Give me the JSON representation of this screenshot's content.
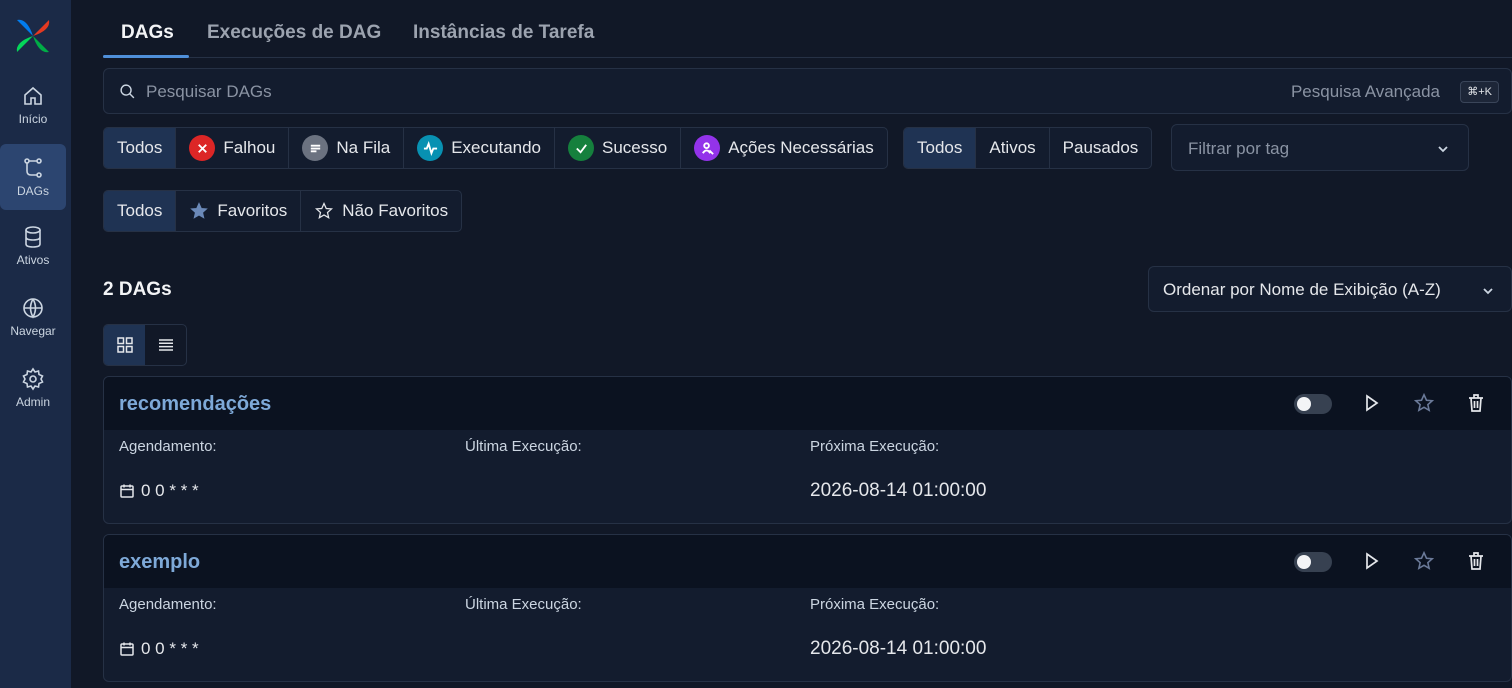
{
  "sidebar": {
    "items": [
      {
        "label": "Início",
        "icon": "home-icon"
      },
      {
        "label": "DAGs",
        "icon": "dags-icon"
      },
      {
        "label": "Ativos",
        "icon": "database-icon"
      },
      {
        "label": "Navegar",
        "icon": "globe-icon"
      },
      {
        "label": "Admin",
        "icon": "gear-icon"
      }
    ]
  },
  "tabs": [
    {
      "label": "DAGs"
    },
    {
      "label": "Execuções de DAG"
    },
    {
      "label": "Instâncias de Tarefa"
    }
  ],
  "search": {
    "placeholder": "Pesquisar DAGs",
    "advanced_label": "Pesquisa Avançada",
    "shortcut": "⌘+K"
  },
  "state_filters": {
    "all": "Todos",
    "failed": "Falhou",
    "queued": "Na Fila",
    "running": "Executando",
    "success": "Sucesso",
    "needs_action": "Ações Necessárias"
  },
  "active_filters": {
    "all": "Todos",
    "active": "Ativos",
    "paused": "Pausados"
  },
  "tag_filter": {
    "placeholder": "Filtrar por tag"
  },
  "favorite_filters": {
    "all": "Todos",
    "favorites": "Favoritos",
    "not_favorites": "Não Favoritos"
  },
  "dag_count": "2 DAGs",
  "sort": {
    "label": "Ordenar por Nome de Exibição (A-Z)"
  },
  "labels": {
    "schedule": "Agendamento:",
    "last_run": "Última Execução:",
    "next_run": "Próxima Execução:"
  },
  "dags": [
    {
      "name": "recomendações",
      "schedule": "0 0 * * *",
      "last_run": "",
      "next_run": "2026-08-14 01:00:00"
    },
    {
      "name": "exemplo",
      "schedule": "0 0 * * *",
      "last_run": "",
      "next_run": "2026-08-14 01:00:00"
    }
  ],
  "colors": {
    "failed": "#dc2626",
    "queued": "#6b7280",
    "running": "#0891b2",
    "success": "#15803d",
    "needs_action": "#9333ea",
    "accent": "#4f8fd9",
    "dag_name": "#7ea9d8"
  }
}
